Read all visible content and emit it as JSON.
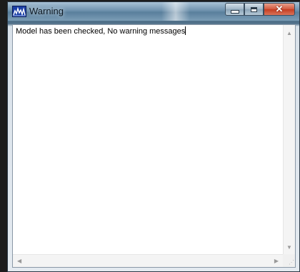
{
  "window": {
    "title": "Warning",
    "icon": "chart-app-icon",
    "controls": {
      "minimize": "minimize-icon",
      "maximize": "maximize-icon",
      "close": "close-icon",
      "close_glyph": "✕"
    }
  },
  "content": {
    "message": "Model has been checked, No warning messages"
  },
  "scrollbars": {
    "up_arrow": "▲",
    "down_arrow": "▼",
    "left_arrow": "◀",
    "right_arrow": "▶"
  },
  "colors": {
    "close_button": "#c43d21",
    "titlebar": "#6f92ad",
    "icon_bg": "#1b3fa6"
  }
}
